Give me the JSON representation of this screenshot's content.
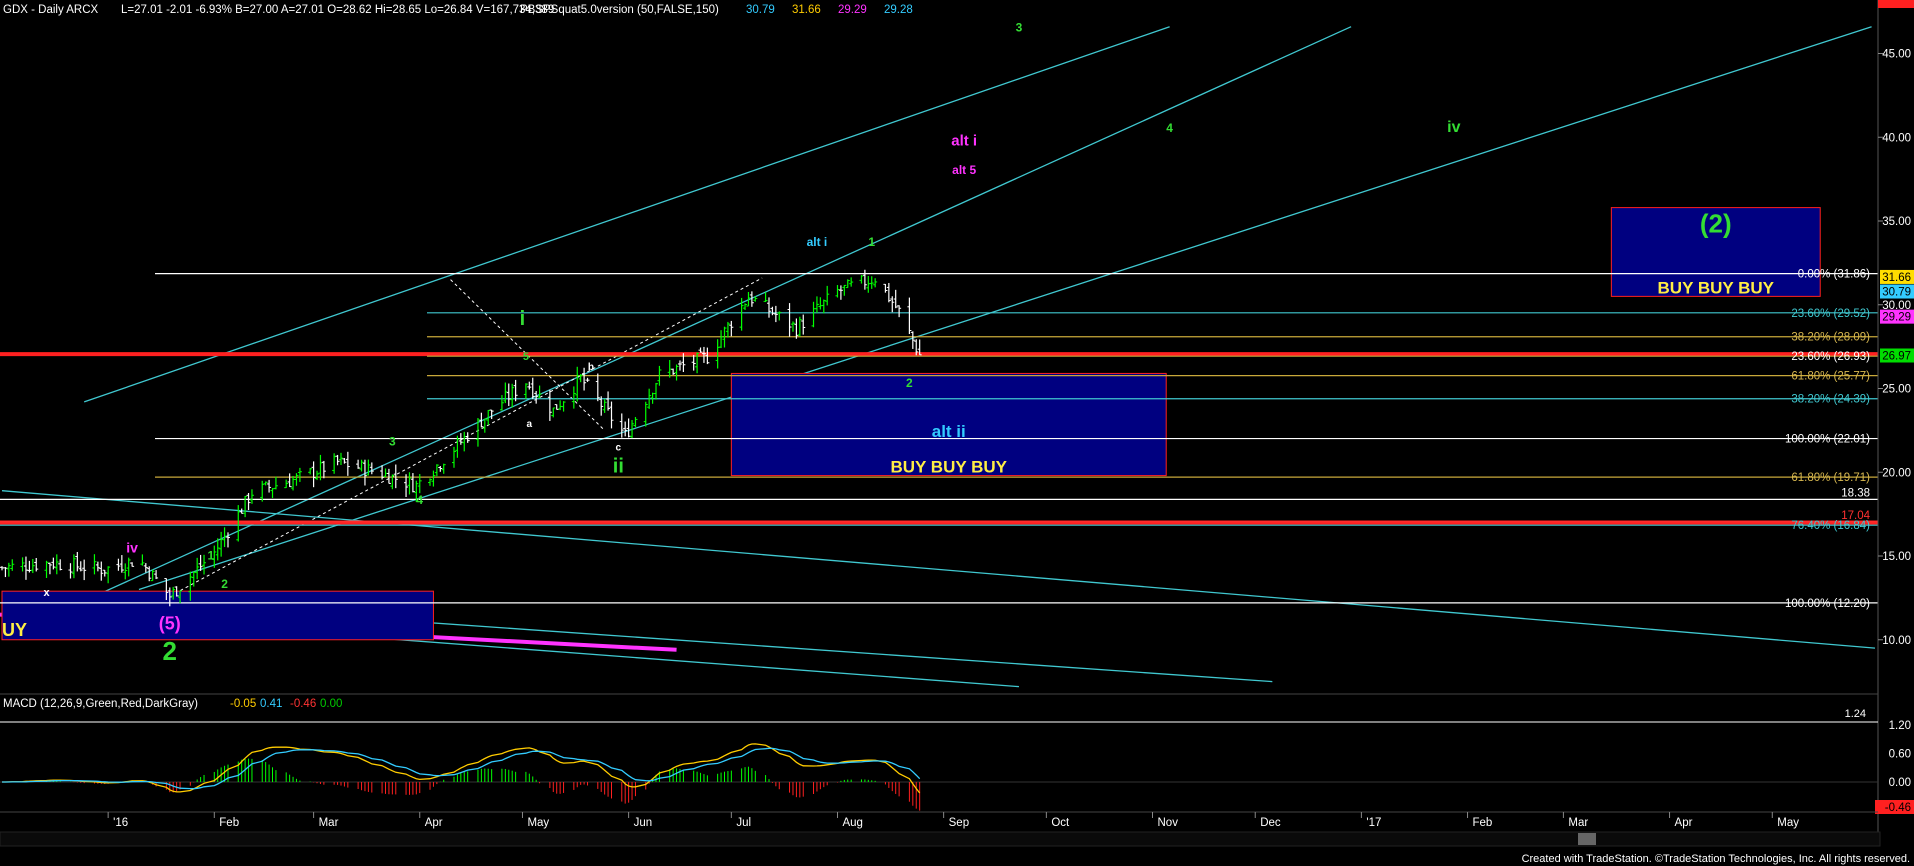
{
  "header": {
    "symbol": "GDX - Daily  ARCX",
    "stats": "L=27.01  -2.01  -6.93%  B=27.00  A=27.01  O=28.62  Hi=28.65  Lo=26.84  V=167,734,389",
    "indicator": "PBSPSquat5.0version (50,FALSE,150)",
    "ind_values": [
      {
        "text": "30.79",
        "color": "#33ccff"
      },
      {
        "text": "31.66",
        "color": "#ffcc00"
      },
      {
        "text": "29.29",
        "color": "#ff33ff"
      },
      {
        "text": "29.28",
        "color": "#33ccff"
      }
    ]
  },
  "macd_header": {
    "title": "MACD (12,26,9,Green,Red,DarkGray)",
    "values": [
      {
        "text": "-0.05",
        "color": "#ffcc00"
      },
      {
        "text": "0.41",
        "color": "#33ccff"
      },
      {
        "text": "-0.46",
        "color": "#ff3333"
      },
      {
        "text": "0.00",
        "color": "#00cc00"
      }
    ]
  },
  "footer": {
    "credit": "Created with TradeStation. ©TradeStation Technologies, Inc. All rights reserved."
  },
  "colors": {
    "background": "#000000",
    "up_bar": "#00ff00",
    "down_bar": "#ffffff",
    "channel": "#40c8d0",
    "fib_line": "#ffffff",
    "support_red": "#ff2020",
    "box_fill": "#000080",
    "box_stroke": "#ff2020",
    "wave_green": "#33dd33",
    "wave_magenta": "#ff33ff",
    "wave_cyan": "#33ccff",
    "buy_yellow": "#ffee44"
  },
  "chart_data": {
    "type": "ohlc",
    "symbol": "GDX",
    "interval": "Daily",
    "ylim": [
      7,
      47
    ],
    "price_ticks": [
      "45.00",
      "40.00",
      "35.00",
      "30.00",
      "25.00",
      "20.00",
      "15.00",
      "10.00"
    ],
    "macd_ticks": [
      "1.20",
      "0.60",
      "0.00",
      "-0.46"
    ],
    "macd_topline": "1.24",
    "x_labels": [
      "'16",
      "Feb",
      "Mar",
      "Apr",
      "May",
      "Jun",
      "Jul",
      "Aug",
      "Sep",
      "Oct",
      "Nov",
      "Dec",
      "'17",
      "Feb",
      "Mar",
      "Apr",
      "May"
    ],
    "price_series": [
      {
        "date": "2015-12-01",
        "close": 14.3
      },
      {
        "date": "2015-12-15",
        "close": 14.6
      },
      {
        "date": "2015-12-31",
        "close": 14.2
      },
      {
        "date": "2016-01-10",
        "close": 14.8
      },
      {
        "date": "2016-01-19",
        "close": 12.6
      },
      {
        "date": "2016-02-01",
        "close": 15.2
      },
      {
        "date": "2016-02-12",
        "close": 18.8
      },
      {
        "date": "2016-02-25",
        "close": 19.6
      },
      {
        "date": "2016-03-08",
        "close": 20.6
      },
      {
        "date": "2016-03-20",
        "close": 20.0
      },
      {
        "date": "2016-03-31",
        "close": 19.2
      },
      {
        "date": "2016-04-10",
        "close": 21.2
      },
      {
        "date": "2016-04-22",
        "close": 23.7
      },
      {
        "date": "2016-05-02",
        "close": 25.4
      },
      {
        "date": "2016-05-10",
        "close": 23.7
      },
      {
        "date": "2016-05-18",
        "close": 25.6
      },
      {
        "date": "2016-05-31",
        "close": 22.2
      },
      {
        "date": "2016-06-10",
        "close": 25.8
      },
      {
        "date": "2016-06-24",
        "close": 26.9
      },
      {
        "date": "2016-07-06",
        "close": 30.5
      },
      {
        "date": "2016-07-20",
        "close": 28.6
      },
      {
        "date": "2016-08-01",
        "close": 30.8
      },
      {
        "date": "2016-08-12",
        "close": 31.6
      },
      {
        "date": "2016-08-19",
        "close": 29.6
      },
      {
        "date": "2016-08-25",
        "close": 27.0
      }
    ],
    "fib_levels": [
      {
        "label": "0.00% (31.86)",
        "value": 31.86
      },
      {
        "label": "23.60% (29.52)",
        "value": 29.52
      },
      {
        "label": "38.20% (28.09)",
        "value": 28.09
      },
      {
        "label": "23.60% (26.93)",
        "value": 26.93
      },
      {
        "label": "61.80% (25.77)",
        "value": 25.77
      },
      {
        "label": "38.20% (24.39)",
        "value": 24.39
      },
      {
        "label": "100.00% (22.01)",
        "value": 22.01
      },
      {
        "label": "61.80% (19.71)",
        "value": 19.71
      },
      {
        "label": "18.38",
        "value": 18.38
      },
      {
        "label": "17.04",
        "value": 17.04
      },
      {
        "label": "76.40% (16.84)",
        "value": 16.84
      },
      {
        "label": "100.00% (12.20)",
        "value": 12.2
      }
    ],
    "right_tags": [
      {
        "text": "31.66",
        "value": 31.66,
        "bg": "#ffdd00",
        "fg": "#000000"
      },
      {
        "text": "30.79",
        "value": 30.79,
        "bg": "#33ccff",
        "fg": "#000000"
      },
      {
        "text": "29.29",
        "value": 29.29,
        "bg": "#ff33ff",
        "fg": "#000000"
      },
      {
        "text": "26.97",
        "value": 26.97,
        "bg": "#00dd00",
        "fg": "#000000"
      }
    ],
    "boxes": [
      {
        "name": "upper-target-box",
        "date_from": "2017-03-15",
        "date_to": "2017-05-15",
        "y_from": 30.5,
        "y_to": 35.8,
        "label_top": "(2)",
        "label_bottom": "BUY BUY BUY"
      },
      {
        "name": "mid-buy-box",
        "date_from": "2016-07-01",
        "date_to": "2016-11-05",
        "y_from": 19.8,
        "y_to": 25.9,
        "label_top": "alt ii",
        "label_bottom": "BUY  BUY   BUY"
      },
      {
        "name": "lower-buy-box",
        "date_from": "2015-12-01",
        "date_to": "2016-04-05",
        "y_from": 10.0,
        "y_to": 12.9,
        "label_top": "",
        "label_bottom": "UY"
      }
    ],
    "wave_labels": [
      {
        "text": "3",
        "date": "2016-09-23",
        "y": 46.3,
        "color": "wave_green",
        "size": 12
      },
      {
        "text": "alt i",
        "date": "2016-09-07",
        "y": 39.5,
        "color": "wave_magenta",
        "size": 15
      },
      {
        "text": "alt 5",
        "date": "2016-09-07",
        "y": 37.8,
        "color": "wave_magenta",
        "size": 12
      },
      {
        "text": "4",
        "date": "2016-11-06",
        "y": 40.3,
        "color": "wave_green",
        "size": 12
      },
      {
        "text": "iv",
        "date": "2017-01-28",
        "y": 40.3,
        "color": "wave_green",
        "size": 16
      },
      {
        "text": "alt i",
        "date": "2016-07-26",
        "y": 33.5,
        "color": "wave_cyan",
        "size": 12
      },
      {
        "text": "1",
        "date": "2016-08-11",
        "y": 33.5,
        "color": "wave_green",
        "size": 12
      },
      {
        "text": "i",
        "date": "2016-05-01",
        "y": 28.8,
        "color": "wave_green",
        "size": 20
      },
      {
        "text": "5",
        "date": "2016-05-02",
        "y": 26.7,
        "color": "wave_green",
        "size": 11
      },
      {
        "text": "b",
        "date": "2016-05-21",
        "y": 26.1,
        "color": "#ffffff",
        "size": 10
      },
      {
        "text": "a",
        "date": "2016-05-03",
        "y": 22.7,
        "color": "#ffffff",
        "size": 10
      },
      {
        "text": "c",
        "date": "2016-05-29",
        "y": 21.3,
        "color": "#ffffff",
        "size": 10
      },
      {
        "text": "ii",
        "date": "2016-05-29",
        "y": 20.0,
        "color": "wave_green",
        "size": 20
      },
      {
        "text": "2",
        "date": "2016-08-22",
        "y": 25.1,
        "color": "wave_green",
        "size": 12
      },
      {
        "text": "3",
        "date": "2016-03-24",
        "y": 21.6,
        "color": "wave_green",
        "size": 12
      },
      {
        "text": "4",
        "date": "2016-04-01",
        "y": 18.1,
        "color": "wave_green",
        "size": 12
      },
      {
        "text": "iv",
        "date": "2016-01-08",
        "y": 15.2,
        "color": "wave_magenta",
        "size": 14
      },
      {
        "text": "1",
        "date": "2016-01-31",
        "y": 14.8,
        "color": "wave_green",
        "size": 12
      },
      {
        "text": "2",
        "date": "2016-02-04",
        "y": 13.1,
        "color": "wave_green",
        "size": 12
      },
      {
        "text": "x",
        "date": "2015-12-14",
        "y": 12.6,
        "color": "#ffffff",
        "size": 11
      },
      {
        "text": "(5)",
        "date": "2016-01-19",
        "y": 10.6,
        "color": "wave_magenta",
        "size": 18
      },
      {
        "text": "2",
        "date": "2016-01-19",
        "y": 8.8,
        "color": "wave_green",
        "size": 26
      }
    ]
  }
}
